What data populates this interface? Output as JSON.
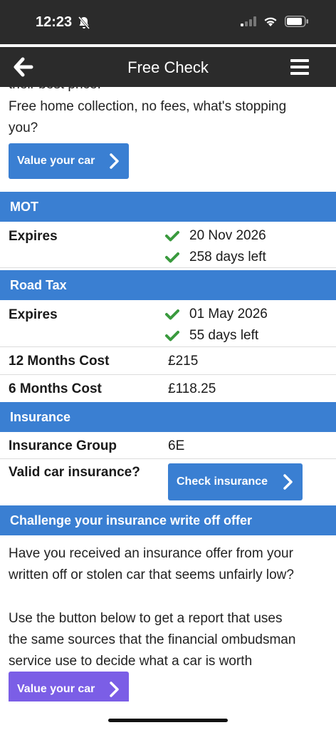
{
  "status": {
    "time": "12:23"
  },
  "topbar": {
    "title": "Free Check"
  },
  "intro": {
    "line_partial": "their best price.",
    "line1": "Free home collection, no fees, what's stopping",
    "line2": "you?",
    "button_label": "Value your car"
  },
  "mot": {
    "header": "MOT",
    "expires_label": "Expires",
    "date": "20 Nov 2026",
    "days_left": "258 days left"
  },
  "road_tax": {
    "header": "Road Tax",
    "expires_label": "Expires",
    "date": "01 May 2026",
    "days_left": "55 days left",
    "cost12_label": "12 Months Cost",
    "cost12_value": "£215",
    "cost6_label": "6 Months Cost",
    "cost6_value": "£118.25"
  },
  "insurance": {
    "header": "Insurance",
    "group_label": "Insurance Group",
    "group_value": "6E",
    "valid_label": "Valid car insurance?",
    "check_button": "Check insurance"
  },
  "challenge": {
    "header": "Challenge your insurance write off offer",
    "p1_line1": "Have you received an insurance offer from your",
    "p1_line2": "written off or stolen car that seems unfairly low?",
    "p2_line1": "Use the button below to get a report that uses",
    "p2_line2": "the same sources that the financial ombudsman",
    "p2_line3": "service use to decide what a car is worth",
    "button_label": "Value your car"
  },
  "colors": {
    "accent": "#3a7fd2",
    "purple": "#7b5ee6",
    "check_green": "#3a9a3e",
    "bar": "#2b2b2b"
  }
}
